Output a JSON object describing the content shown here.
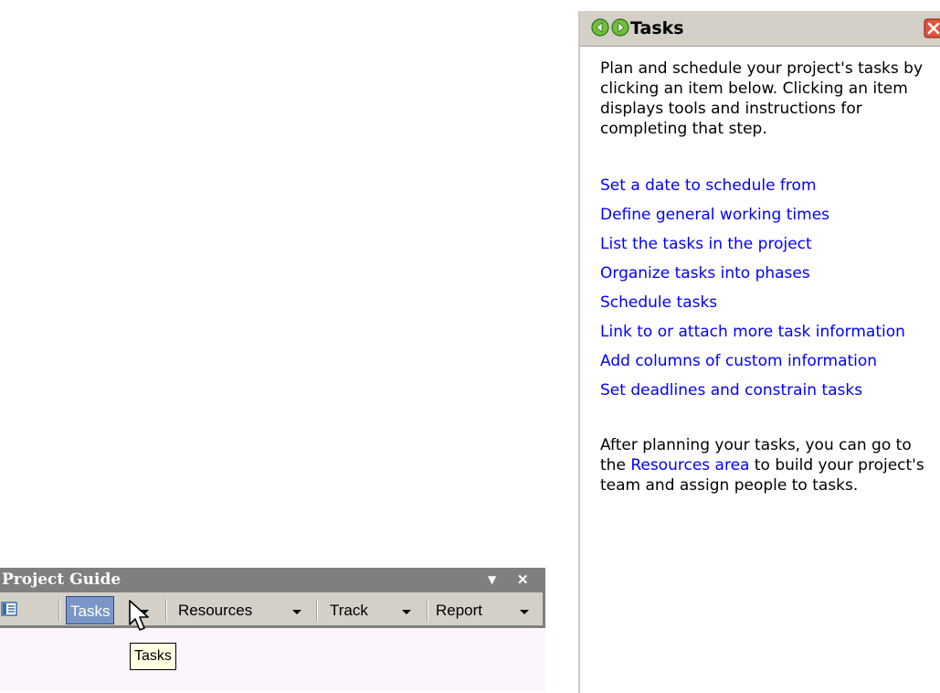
{
  "project_guide": {
    "title": "Project Guide",
    "dropdown_glyph": "▼",
    "close_glyph": "✕",
    "items": [
      {
        "label": "Tasks"
      },
      {
        "label": "Resources"
      },
      {
        "label": "Track"
      },
      {
        "label": "Report"
      }
    ],
    "tooltip": "Tasks"
  },
  "task_pane": {
    "title": "Tasks",
    "intro": "Plan and schedule your project's tasks by clicking an item below. Clicking an item displays tools and instructions for completing that step.",
    "links": [
      "Set a date to schedule from",
      "Define general working times",
      "List the tasks in the project",
      "Organize tasks into phases",
      "Schedule tasks",
      "Link to or attach more task information",
      "Add columns of custom information",
      "Set deadlines and constrain tasks"
    ],
    "outro_before": "After planning your tasks, you can go to the ",
    "outro_link": "Resources area",
    "outro_after": " to build your project's team and assign people to tasks."
  },
  "colors": {
    "link": "#0000ff",
    "active_tab": "#7a96c6",
    "toolbar": "#d4d0c8",
    "titlebar": "#7f7f7f",
    "tooltip_bg": "#ffffe1"
  },
  "icons": [
    "pane-icon",
    "chevron-down-icon",
    "close-icon",
    "back-arrow-icon",
    "forward-arrow-icon",
    "pane-close-icon",
    "pointer-cursor-icon"
  ]
}
